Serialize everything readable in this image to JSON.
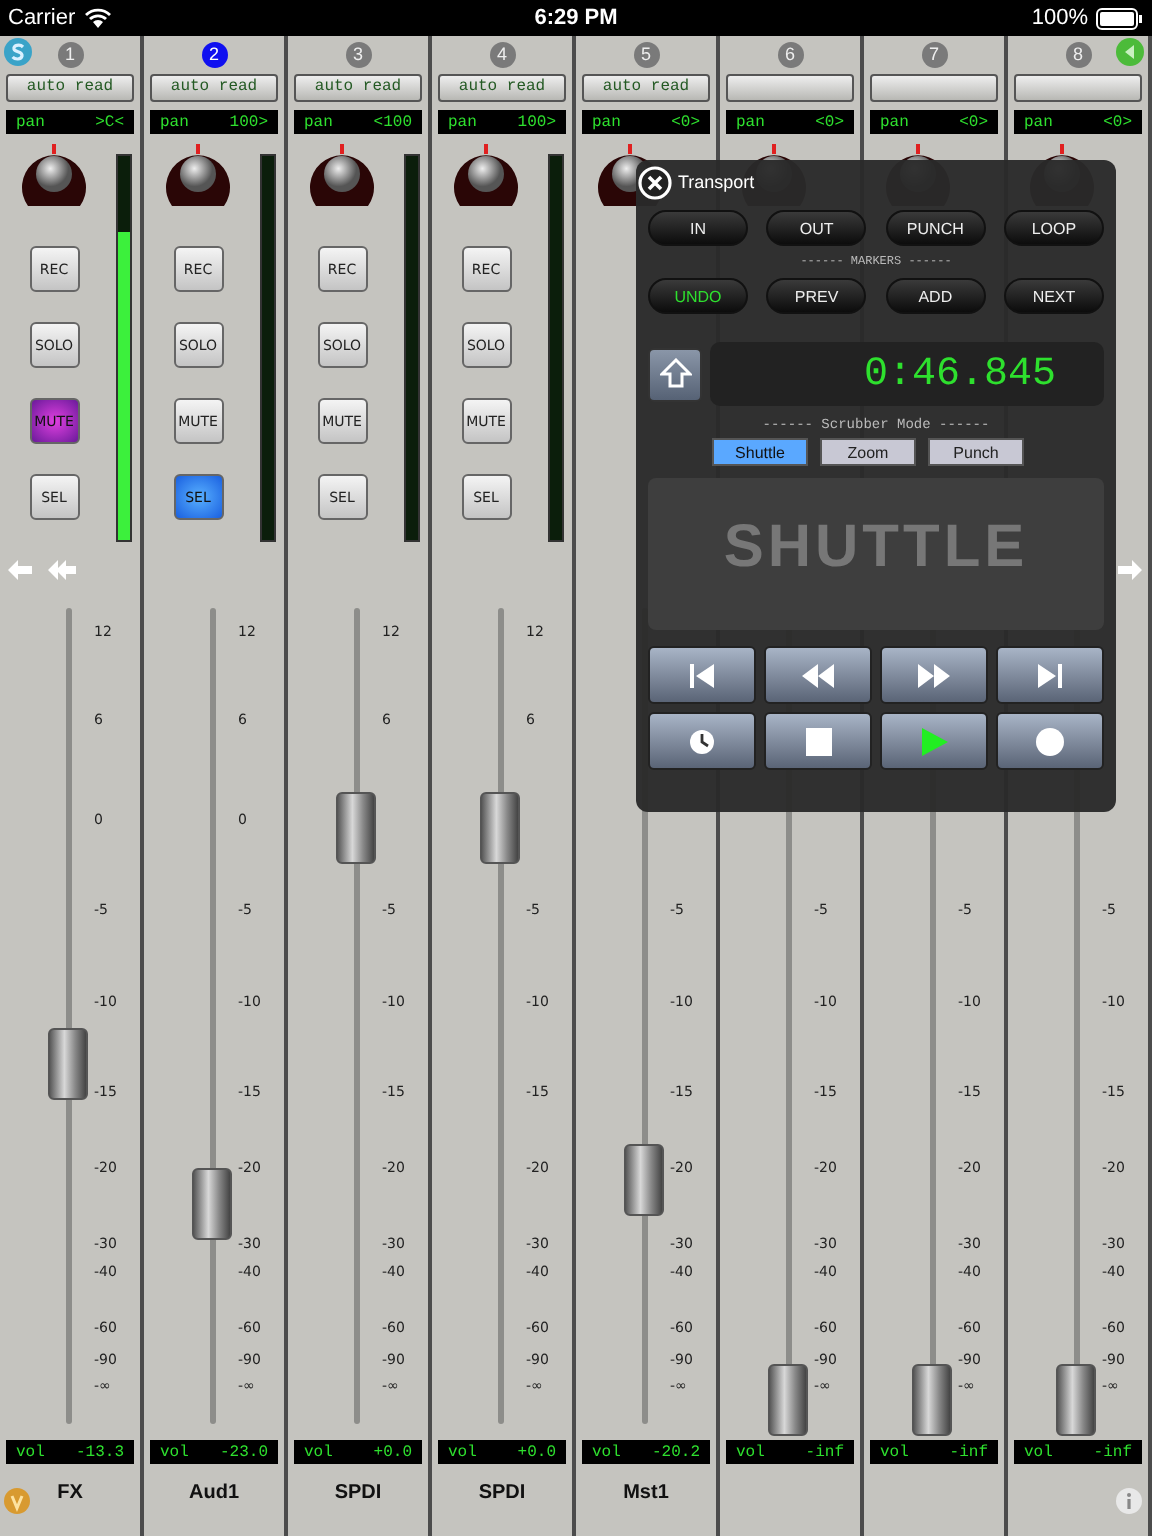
{
  "status_bar": {
    "carrier": "Carrier",
    "time": "6:29 PM",
    "battery": "100%"
  },
  "channels": [
    {
      "number": "1",
      "selected": false,
      "auto": "auto read",
      "pan_label": "pan",
      "pan": ">C<",
      "meter": {
        "level": 0.8
      },
      "buttons": [
        {
          "kind": "rec",
          "label": "REC",
          "on": false
        },
        {
          "kind": "solo",
          "label": "SOLO",
          "on": false
        },
        {
          "kind": "mute",
          "label": "MUTE",
          "on": true
        },
        {
          "kind": "sel",
          "label": "SEL",
          "on": false
        }
      ],
      "scale": [
        "12",
        "6",
        "0",
        "-5",
        "-10",
        "-15",
        "-20",
        "-30",
        "-40",
        "-60",
        "-90",
        "-∞"
      ],
      "fader": {
        "level": 0.44
      },
      "vol_label": "vol",
      "vol": "-13.3",
      "name": "FX"
    },
    {
      "number": "2",
      "selected": true,
      "auto": "auto read",
      "pan_label": "pan",
      "pan": "100>",
      "meter": {
        "level": 0
      },
      "buttons": [
        {
          "kind": "rec",
          "label": "REC",
          "on": false
        },
        {
          "kind": "solo",
          "label": "SOLO",
          "on": false
        },
        {
          "kind": "mute",
          "label": "MUTE",
          "on": false
        },
        {
          "kind": "sel",
          "label": "SEL",
          "on": true
        }
      ],
      "scale": [
        "12",
        "6",
        "0",
        "-5",
        "-10",
        "-15",
        "-20",
        "-30",
        "-40",
        "-60",
        "-90",
        "-∞"
      ],
      "fader": {
        "level": 0.27
      },
      "vol_label": "vol",
      "vol": "-23.0",
      "name": "Aud1"
    },
    {
      "number": "3",
      "selected": false,
      "auto": "auto read",
      "pan_label": "pan",
      "pan": "<100",
      "meter": {
        "level": 0
      },
      "buttons": [
        {
          "kind": "rec",
          "label": "REC",
          "on": false
        },
        {
          "kind": "solo",
          "label": "SOLO",
          "on": false
        },
        {
          "kind": "mute",
          "label": "MUTE",
          "on": false
        },
        {
          "kind": "sel",
          "label": "SEL",
          "on": false
        }
      ],
      "scale": [
        "12",
        "6",
        "-5",
        "-10",
        "-15",
        "-20",
        "-30",
        "-40",
        "-60",
        "-90",
        "-∞"
      ],
      "fader": {
        "level": 0.73
      },
      "vol_label": "vol",
      "vol": "+0.0",
      "name": "SPDI"
    },
    {
      "number": "4",
      "selected": false,
      "auto": "auto read",
      "pan_label": "pan",
      "pan": "100>",
      "meter": {
        "level": 0
      },
      "buttons": [
        {
          "kind": "rec",
          "label": "REC",
          "on": false
        },
        {
          "kind": "solo",
          "label": "SOLO",
          "on": false
        },
        {
          "kind": "mute",
          "label": "MUTE",
          "on": false
        },
        {
          "kind": "sel",
          "label": "SEL",
          "on": false
        }
      ],
      "scale": [
        "12",
        "6",
        "-5",
        "-10",
        "-15",
        "-20",
        "-30",
        "-40",
        "-60",
        "-90",
        "-∞"
      ],
      "fader": {
        "level": 0.73
      },
      "vol_label": "vol",
      "vol": "+0.0",
      "name": "SPDI"
    },
    {
      "number": "5",
      "selected": false,
      "auto": "auto read",
      "pan_label": "pan",
      "pan": "<0>",
      "scale": [
        "-5",
        "-10",
        "-15",
        "-20",
        "-30",
        "-40",
        "-60",
        "-90",
        "-∞"
      ],
      "fader": {
        "level": 0.3
      },
      "vol_label": "vol",
      "vol": "-20.2",
      "name": "Mst1"
    },
    {
      "number": "6",
      "selected": false,
      "pan_label": "pan",
      "pan": "<0>",
      "scale": [
        "-5",
        "-10",
        "-15",
        "-20",
        "-30",
        "-40",
        "-60",
        "-90",
        "-∞"
      ],
      "fader": {
        "level": 0.03
      },
      "vol_label": "vol",
      "vol": "-inf"
    },
    {
      "number": "7",
      "selected": false,
      "pan_label": "pan",
      "pan": "<0>",
      "scale": [
        "-5",
        "-10",
        "-15",
        "-20",
        "-30",
        "-40",
        "-60",
        "-90",
        "-∞"
      ],
      "fader": {
        "level": 0.03
      },
      "vol_label": "vol",
      "vol": "-inf"
    },
    {
      "number": "8",
      "selected": false,
      "pan_label": "pan",
      "pan": "<0>",
      "scale": [
        "-5",
        "-10",
        "-15",
        "-20",
        "-30",
        "-40",
        "-60",
        "-90",
        "-∞"
      ],
      "fader": {
        "level": 0.03
      },
      "vol_label": "vol",
      "vol": "-inf"
    }
  ],
  "transport": {
    "title": "Transport",
    "row_1": [
      {
        "label": "IN",
        "on": false
      },
      {
        "label": "OUT",
        "on": false
      },
      {
        "label": "PUNCH",
        "on": false
      },
      {
        "label": "LOOP",
        "on": false
      }
    ],
    "markers_label": "------ MARKERS ------",
    "row_2": [
      {
        "label": "UNDO",
        "on": true
      },
      {
        "label": "PREV",
        "on": false
      },
      {
        "label": "ADD",
        "on": false
      },
      {
        "label": "NEXT",
        "on": false
      }
    ],
    "time": "0:46.845",
    "scrubber_label": "------ Scrubber Mode ------",
    "modes": [
      {
        "label": "Shuttle",
        "selected": true
      },
      {
        "label": "Zoom",
        "selected": false
      },
      {
        "label": "Punch",
        "selected": false
      }
    ],
    "mode_display": "SHUTTLE",
    "controls": [
      {
        "kind": "to-start",
        "on": false
      },
      {
        "kind": "rewind",
        "on": false
      },
      {
        "kind": "fast-forward",
        "on": false
      },
      {
        "kind": "to-end",
        "on": false
      },
      {
        "kind": "clock",
        "on": false
      },
      {
        "kind": "stop",
        "on": false
      },
      {
        "kind": "play",
        "on": true
      },
      {
        "kind": "record",
        "on": false
      }
    ]
  }
}
